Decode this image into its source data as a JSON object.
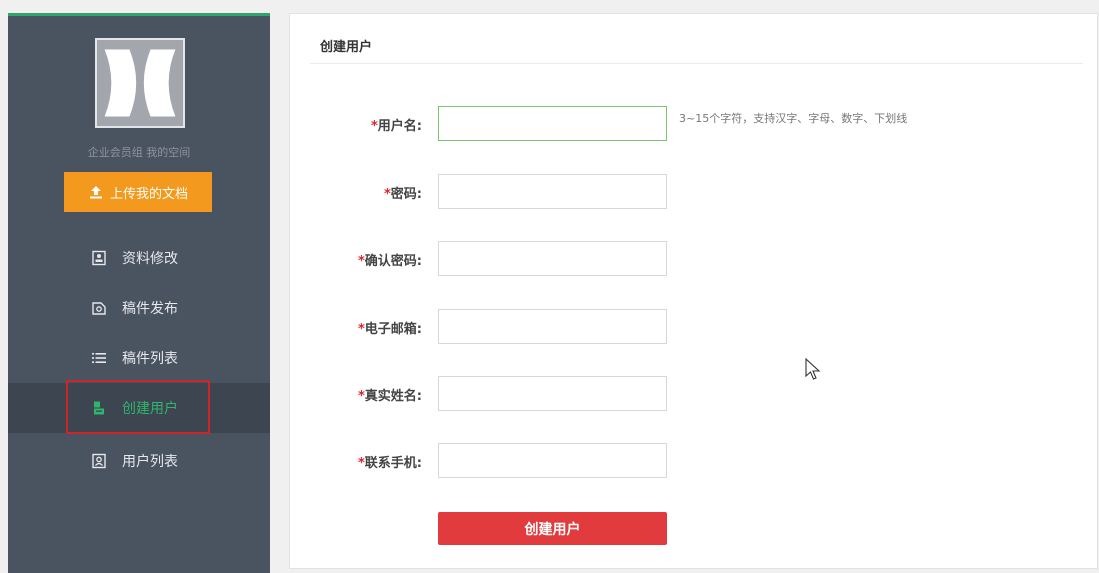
{
  "sidebar": {
    "member_text": "企业会员组  我的空间",
    "upload_label": "上传我的文档",
    "items": [
      {
        "label": "资料修改",
        "icon": "profile-edit-icon"
      },
      {
        "label": "稿件发布",
        "icon": "publish-icon"
      },
      {
        "label": "稿件列表",
        "icon": "list-icon"
      },
      {
        "label": "创建用户",
        "icon": "create-user-icon",
        "active": true
      },
      {
        "label": "用户列表",
        "icon": "user-list-icon"
      }
    ],
    "colors": {
      "bg": "#4a5360",
      "active_text": "#2fb56c",
      "upload_bg": "#f39a1e",
      "highlight_border": "#d0242b"
    }
  },
  "main": {
    "title": "创建用户",
    "fields": [
      {
        "required": "*",
        "label": "用户名:",
        "value": "",
        "hint": "3~15个字符，支持汉字、字母、数字、下划线"
      },
      {
        "required": "*",
        "label": "密码:",
        "value": ""
      },
      {
        "required": "*",
        "label": "确认密码:",
        "value": ""
      },
      {
        "required": "*",
        "label": "电子邮箱:",
        "value": ""
      },
      {
        "required": "*",
        "label": "真实姓名:",
        "value": ""
      },
      {
        "required": "*",
        "label": "联系手机:",
        "value": ""
      }
    ],
    "submit_label": "创建用户",
    "colors": {
      "submit_bg": "#e13b3e",
      "required": "#e0232b"
    }
  }
}
